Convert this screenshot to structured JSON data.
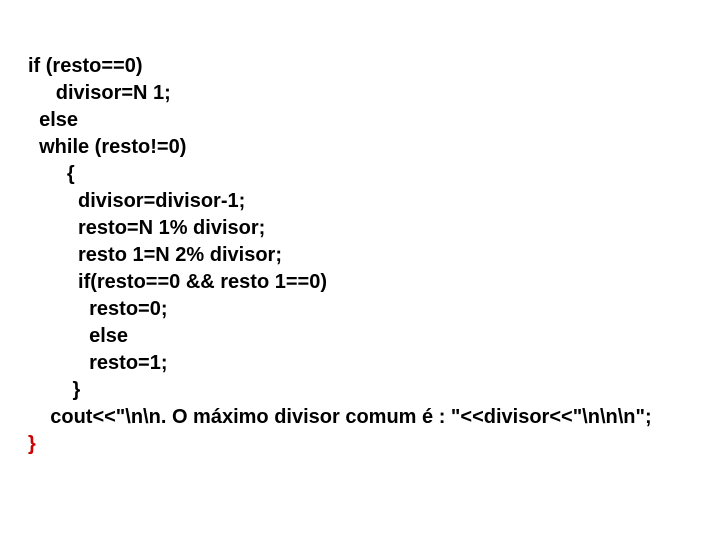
{
  "code": {
    "l1": "if (resto==0)",
    "l2": "     divisor=N 1;",
    "l3": "  else",
    "l4": "  while (resto!=0)",
    "l5": "       {",
    "l6": "         divisor=divisor-1;",
    "l7": "         resto=N 1% divisor;",
    "l8": "         resto 1=N 2% divisor;",
    "l9": "         if(resto==0 && resto 1==0)",
    "l10": "           resto=0;",
    "l11": "           else",
    "l12": "           resto=1;",
    "l13": "        }",
    "l14": "    cout<<\"\\n\\n. O máximo divisor comum é : \"<<divisor<<\"\\n\\n\\n\";",
    "l15": "}"
  }
}
